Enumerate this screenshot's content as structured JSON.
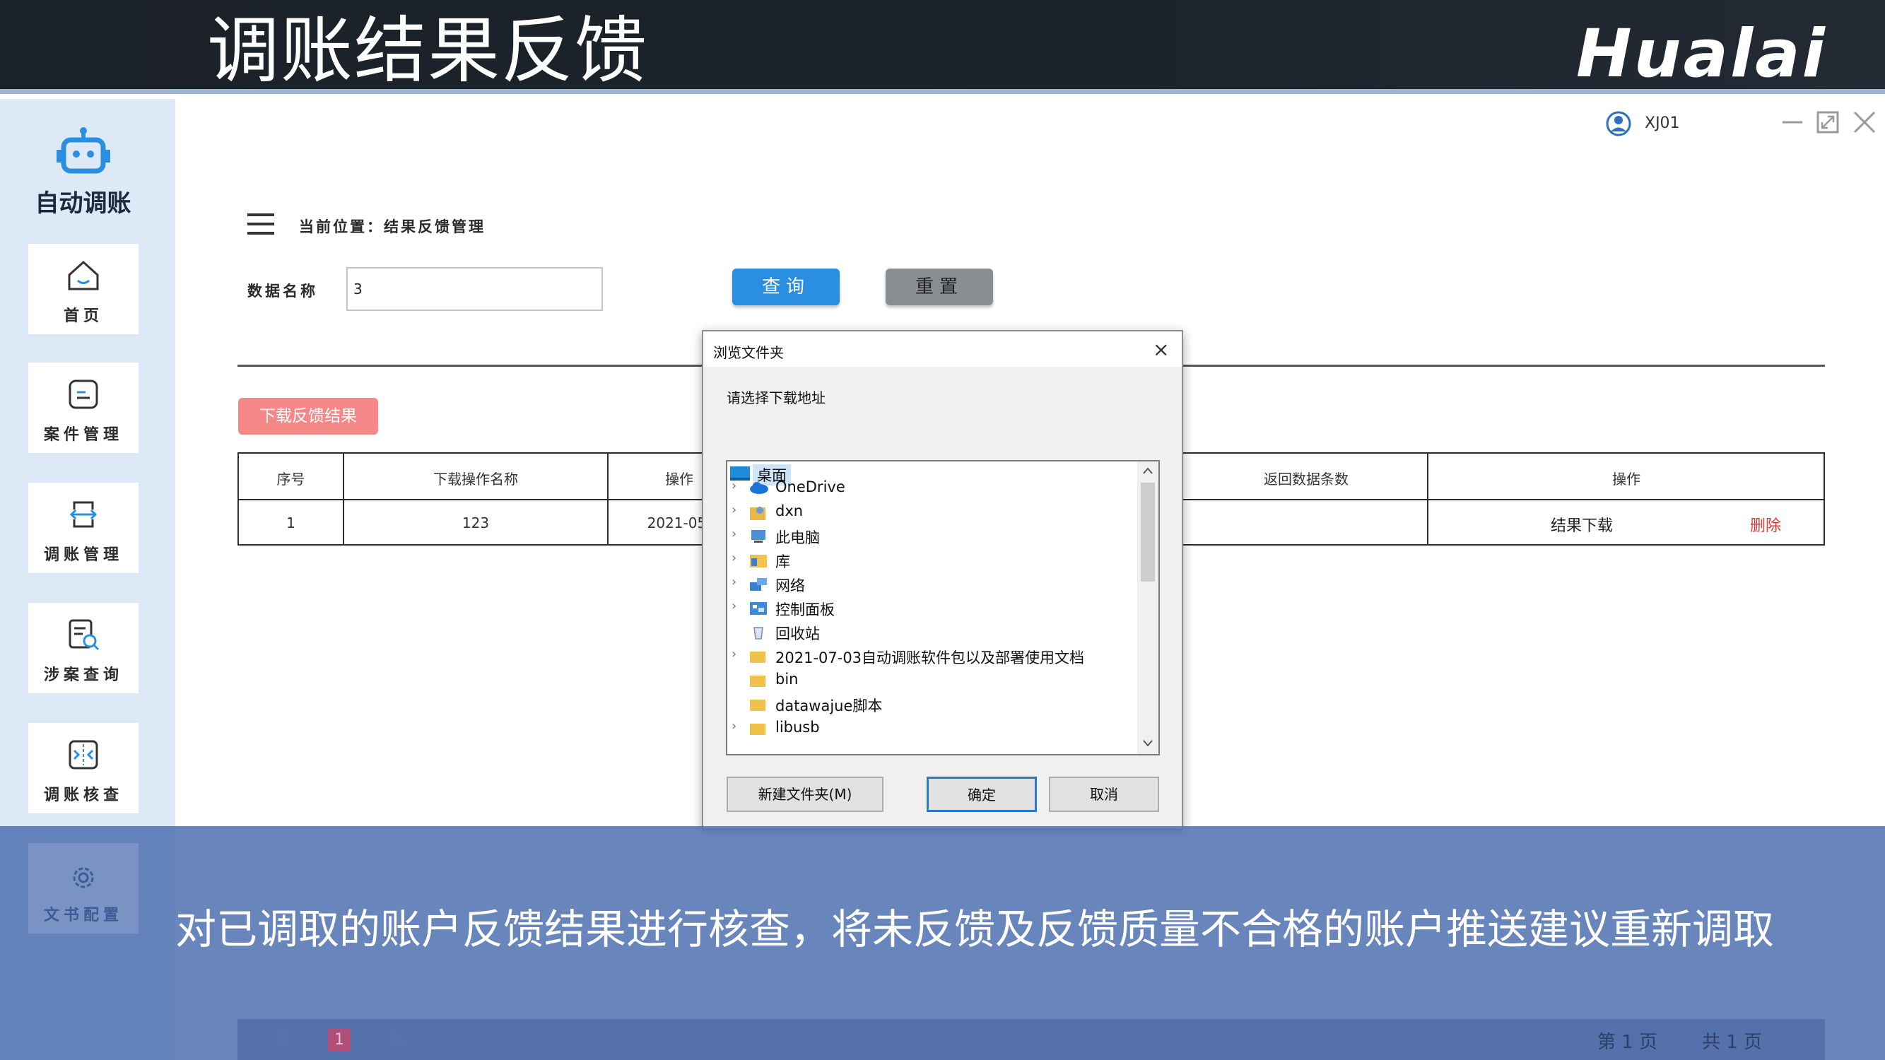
{
  "header": {
    "title": "调账结果反馈",
    "logo_text": "Hualai"
  },
  "sidebar": {
    "app_title": "自动调账",
    "items": [
      {
        "label": "首页",
        "icon": "home-icon"
      },
      {
        "label": "案件管理",
        "icon": "case-icon"
      },
      {
        "label": "调账管理",
        "icon": "transfer-icon"
      },
      {
        "label": "涉案查询",
        "icon": "search-doc-icon"
      },
      {
        "label": "调账核查",
        "icon": "check-icon"
      },
      {
        "label": "文书配置",
        "icon": "gear-icon"
      }
    ]
  },
  "user": {
    "name": "XJ01"
  },
  "breadcrumb": "当前位置：结果反馈管理",
  "search": {
    "label": "数据名称",
    "value": "3",
    "query_label": "查询",
    "reset_label": "重置"
  },
  "download_label": "下载反馈结果",
  "table": {
    "headers": [
      "序号",
      "下载操作名称",
      "操作",
      "返回数据条数",
      "操作"
    ],
    "rows": [
      {
        "index": "1",
        "name": "123",
        "date": "2021-05-",
        "download": "结果下载",
        "delete": "删除"
      }
    ]
  },
  "dialog": {
    "title": "浏览文件夹",
    "prompt": "请选择下载地址",
    "tree": [
      {
        "label": "桌面",
        "icon": "desktop-icon",
        "selected": true
      },
      {
        "label": "OneDrive",
        "icon": "cloud-icon"
      },
      {
        "label": "dxn",
        "icon": "user-folder-icon"
      },
      {
        "label": "此电脑",
        "icon": "computer-icon"
      },
      {
        "label": "库",
        "icon": "library-icon"
      },
      {
        "label": "网络",
        "icon": "network-icon"
      },
      {
        "label": "控制面板",
        "icon": "control-panel-icon"
      },
      {
        "label": "回收站",
        "icon": "recycle-bin-icon"
      },
      {
        "label": "2021-07-03自动调账软件包以及部署使用文档",
        "icon": "folder-icon"
      },
      {
        "label": "bin",
        "icon": "folder-icon"
      },
      {
        "label": "datawajue脚本",
        "icon": "folder-icon"
      },
      {
        "label": "libusb",
        "icon": "folder-icon"
      }
    ],
    "new_folder_label": "新建文件夹(M)",
    "ok_label": "确定",
    "cancel_label": "取消"
  },
  "caption": "对已调取的账户反馈结果进行核查，将未反馈及反馈质量不合格的账户推送建议重新调取",
  "pager": {
    "current": "1",
    "page_text": "第 1 页",
    "total_text": "共 1 页"
  },
  "colors": {
    "accent_blue": "#2a8fe0",
    "danger_red": "#e03a3a",
    "download_pink": "#f58786",
    "overlay_blue": "#4f71b0"
  }
}
